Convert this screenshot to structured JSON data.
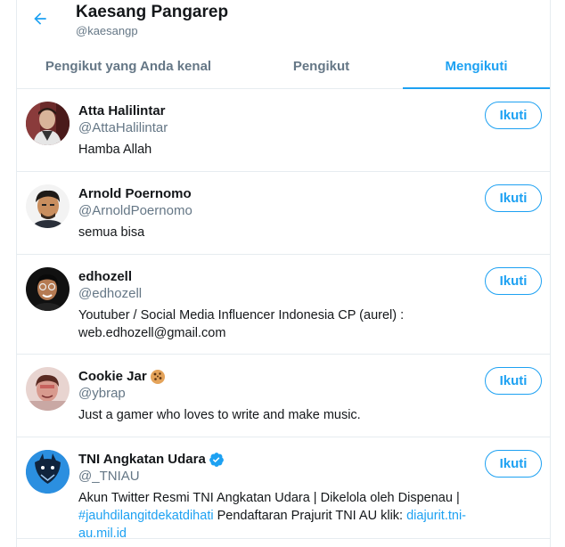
{
  "header": {
    "back_icon": "arrow-left-icon",
    "name": "Kaesang Pangarep",
    "handle": "@kaesangp"
  },
  "tabs": [
    {
      "label": "Pengikut yang Anda kenal",
      "active": false
    },
    {
      "label": "Pengikut",
      "active": false
    },
    {
      "label": "Mengikuti",
      "active": true
    }
  ],
  "accent_color": "#1da1f2",
  "users": [
    {
      "name": "Atta Halilintar",
      "handle": "@AttaHalilintar",
      "bio": "Hamba Allah",
      "button": "Ikuti"
    },
    {
      "name": "Arnold Poernomo",
      "handle": "@ArnoldPoernomo",
      "bio": "semua bisa",
      "button": "Ikuti"
    },
    {
      "name": "edhozell",
      "handle": "@edhozell",
      "bio": "Youtuber / Social Media Influencer Indonesia CP (aurel) : web.edhozell@gmail.com",
      "button": "Ikuti"
    },
    {
      "name": "Cookie Jar",
      "name_emoji": "cookie-icon",
      "handle": "@ybrap",
      "bio": "Just a gamer who loves to write and make music.",
      "button": "Ikuti"
    },
    {
      "name": "TNI Angkatan Udara",
      "verified_icon": "verified-badge-icon",
      "handle": "@_TNIAU",
      "bio_prefix": "Akun Twitter Resmi TNI Angkatan Udara | Dikelola oleh Dispenau | ",
      "bio_hashtag": "#jauhdilangitdekatdihati",
      "bio_middle": " Pendaftaran Prajurit TNI AU klik: ",
      "bio_link": "diajurit.tni-au.mil.id",
      "button": "Ikuti"
    }
  ]
}
